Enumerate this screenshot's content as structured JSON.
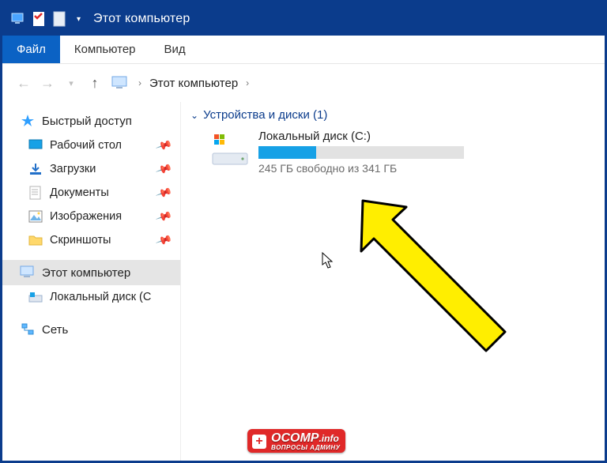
{
  "titlebar": {
    "title": "Этот компьютер"
  },
  "quick_access_icons": [
    "monitor-icon",
    "checklist-icon",
    "document-icon"
  ],
  "ribbon": {
    "tabs": [
      {
        "label": "Файл",
        "active": true
      },
      {
        "label": "Компьютер",
        "active": false
      },
      {
        "label": "Вид",
        "active": false
      }
    ]
  },
  "breadcrumb": {
    "root": "Этот компьютер"
  },
  "sidebar": {
    "quick_access_label": "Быстрый доступ",
    "items": [
      {
        "label": "Рабочий стол",
        "icon": "desktop-icon",
        "pinned": true
      },
      {
        "label": "Загрузки",
        "icon": "downloads-icon",
        "pinned": true
      },
      {
        "label": "Документы",
        "icon": "documents-icon",
        "pinned": true
      },
      {
        "label": "Изображения",
        "icon": "pictures-icon",
        "pinned": true
      },
      {
        "label": "Скриншоты",
        "icon": "folder-icon",
        "pinned": true
      }
    ],
    "this_pc_label": "Этот компьютер",
    "local_disk_label": "Локальный диск (C",
    "network_label": "Сеть"
  },
  "main": {
    "section": {
      "label": "Устройства и диски (1)"
    },
    "drive": {
      "name": "Локальный диск (C:)",
      "free_text": "245 ГБ свободно из 341 ГБ",
      "used_percent": 28
    }
  },
  "watermark": {
    "brand": "OCOMP",
    "tld": ".info",
    "sub": "ВОПРОСЫ АДМИНУ"
  }
}
